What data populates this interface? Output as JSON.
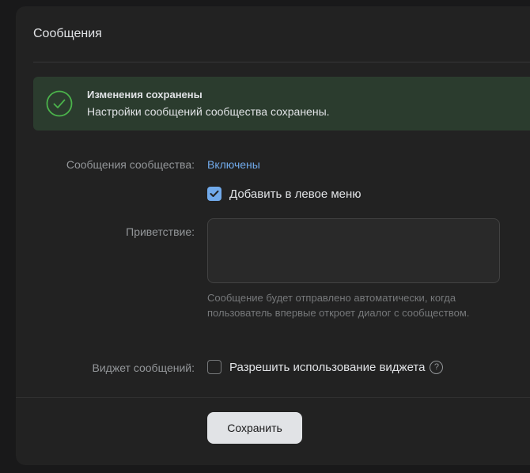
{
  "panel": {
    "title": "Сообщения"
  },
  "alert": {
    "title": "Изменения сохранены",
    "text": "Настройки сообщений сообщества сохранены."
  },
  "settings": {
    "community_messages": {
      "label": "Сообщения сообщества:",
      "value": "Включены"
    },
    "left_menu": {
      "label": "Добавить в левое меню",
      "checked": true
    },
    "greeting": {
      "label": "Приветствие:",
      "value": "",
      "placeholder": "",
      "hint": "Сообщение будет отправлено автоматически, когда пользователь впервые откроет диалог с сообществом."
    },
    "widget": {
      "label": "Виджет сообщений:",
      "checkbox_label": "Разрешить использование виджета",
      "checked": false,
      "help_glyph": "?"
    }
  },
  "footer": {
    "save_label": "Сохранить"
  },
  "colors": {
    "background": "#19191a",
    "panel": "#222222",
    "accent": "#71aaeb",
    "success_bg": "#2b3c2e",
    "success_icon": "#4bb34b"
  },
  "icons": {
    "alert": "check-circle-icon",
    "checkbox_checked": "checkmark-icon",
    "help": "question-circle-icon"
  }
}
